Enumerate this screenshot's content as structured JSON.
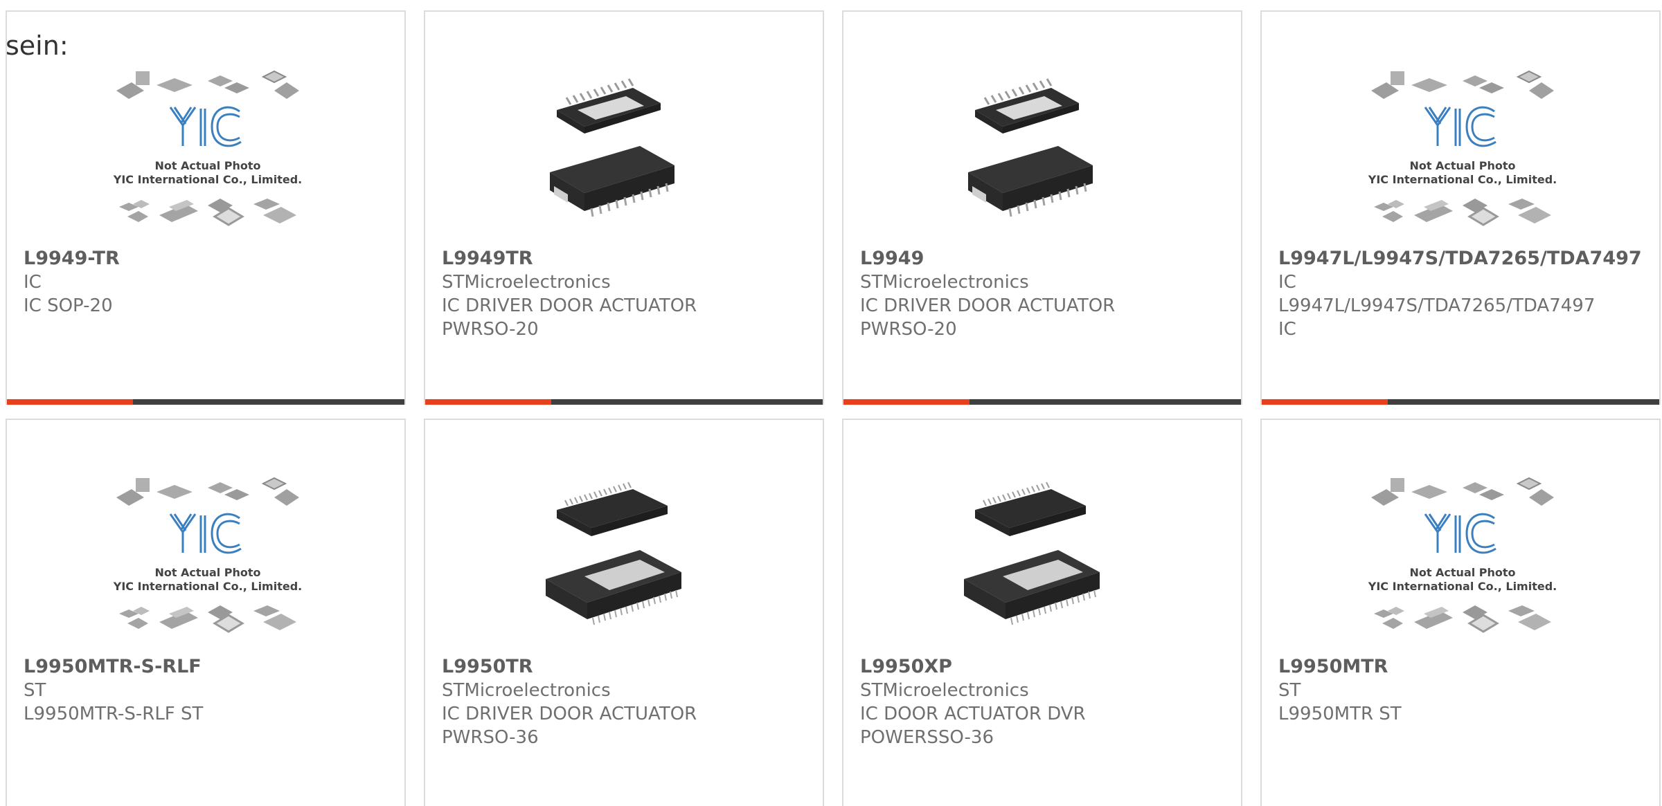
{
  "intro_text": "sein:",
  "placeholder": {
    "line1": "Not Actual Photo",
    "line2": "YIC International Co., Limited."
  },
  "colors": {
    "accent": "#e8401c",
    "bar": "#3f3f3f",
    "logo": "#3a7fc0"
  },
  "products": [
    {
      "part": "L9949-TR",
      "lines": [
        "IC",
        "IC SOP-20"
      ],
      "image": "yic-placeholder-icon"
    },
    {
      "part": "L9949TR",
      "lines": [
        "STMicroelectronics",
        "IC DRIVER DOOR ACTUATOR",
        "PWRSO-20"
      ],
      "image": "ic-chip-20-icon"
    },
    {
      "part": "L9949",
      "lines": [
        "STMicroelectronics",
        "IC DRIVER DOOR ACTUATOR",
        "PWRSO-20"
      ],
      "image": "ic-chip-20-icon"
    },
    {
      "part": "L9947L/L9947S/TDA7265/TDA7497",
      "lines": [
        "IC",
        "L9947L/L9947S/TDA7265/TDA7497",
        "IC"
      ],
      "image": "yic-placeholder-icon"
    },
    {
      "part": "L9950MTR-S-RLF",
      "lines": [
        "ST",
        "L9950MTR-S-RLF ST"
      ],
      "image": "yic-placeholder-icon"
    },
    {
      "part": "L9950TR",
      "lines": [
        "STMicroelectronics",
        "IC DRIVER DOOR ACTUATOR",
        "PWRSO-36"
      ],
      "image": "ic-chip-36-icon"
    },
    {
      "part": "L9950XP",
      "lines": [
        "STMicroelectronics",
        "IC DOOR ACTUATOR DVR",
        "POWERSSO-36"
      ],
      "image": "ic-chip-36-icon"
    },
    {
      "part": "L9950MTR",
      "lines": [
        "ST",
        "L9950MTR ST"
      ],
      "image": "yic-placeholder-icon"
    }
  ]
}
